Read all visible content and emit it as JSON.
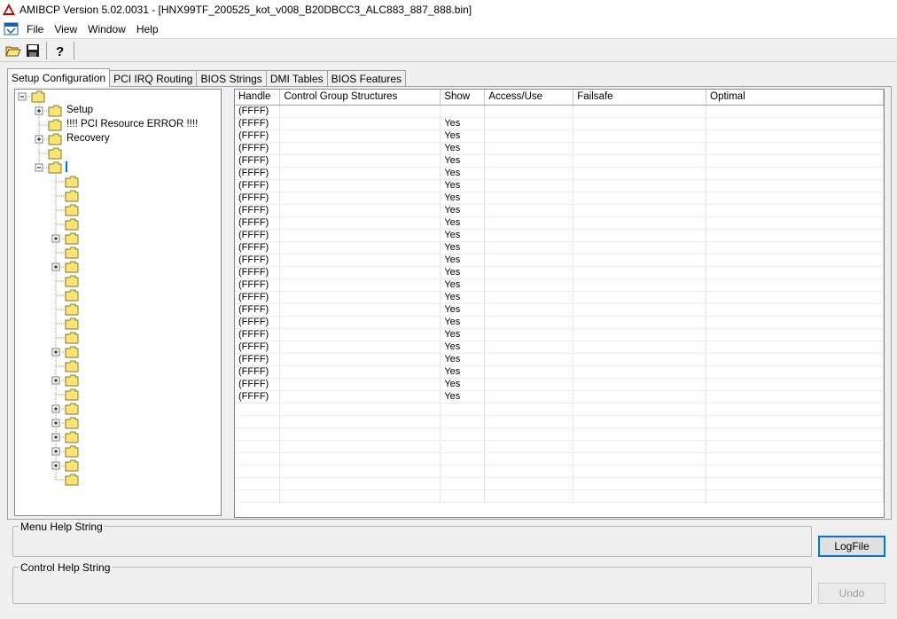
{
  "window": {
    "title": "AMIBCP Version 5.02.0031 - [HNX99TF_200525_kot_v008_B20DBCC3_ALC883_887_888.bin]"
  },
  "menu": [
    "File",
    "View",
    "Window",
    "Help"
  ],
  "toolbar": {
    "icons": [
      "open-folder-icon",
      "save-disk-icon",
      "help-question-icon"
    ]
  },
  "tabs": [
    {
      "label": "Setup Configuration",
      "active": true
    },
    {
      "label": "PCI IRQ Routing",
      "active": false
    },
    {
      "label": "BIOS Strings",
      "active": false
    },
    {
      "label": "DMI Tables",
      "active": false
    },
    {
      "label": "BIOS Features",
      "active": false
    }
  ],
  "tree": {
    "labels": {
      "setup": "Setup",
      "pci_error": "!!!! PCI Resource ERROR !!!!",
      "recovery": "Recovery"
    }
  },
  "table": {
    "columns": [
      "Handle",
      "Control Group Structures",
      "Show",
      "Access/Use",
      "Failsafe",
      "Optimal"
    ],
    "rows": [
      [
        "(FFFF)",
        "",
        "",
        "",
        "",
        ""
      ],
      [
        "(FFFF)",
        "",
        "Yes",
        "",
        "",
        ""
      ],
      [
        "(FFFF)",
        "",
        "Yes",
        "",
        "",
        ""
      ],
      [
        "(FFFF)",
        "",
        "Yes",
        "",
        "",
        ""
      ],
      [
        "(FFFF)",
        "",
        "Yes",
        "",
        "",
        ""
      ],
      [
        "(FFFF)",
        "",
        "Yes",
        "",
        "",
        ""
      ],
      [
        "(FFFF)",
        "",
        "Yes",
        "",
        "",
        ""
      ],
      [
        "(FFFF)",
        "",
        "Yes",
        "",
        "",
        ""
      ],
      [
        "(FFFF)",
        "",
        "Yes",
        "",
        "",
        ""
      ],
      [
        "(FFFF)",
        "",
        "Yes",
        "",
        "",
        ""
      ],
      [
        "(FFFF)",
        "",
        "Yes",
        "",
        "",
        ""
      ],
      [
        "(FFFF)",
        "",
        "Yes",
        "",
        "",
        ""
      ],
      [
        "(FFFF)",
        "",
        "Yes",
        "",
        "",
        ""
      ],
      [
        "(FFFF)",
        "",
        "Yes",
        "",
        "",
        ""
      ],
      [
        "(FFFF)",
        "",
        "Yes",
        "",
        "",
        ""
      ],
      [
        "(FFFF)",
        "",
        "Yes",
        "",
        "",
        ""
      ],
      [
        "(FFFF)",
        "",
        "Yes",
        "",
        "",
        ""
      ],
      [
        "(FFFF)",
        "",
        "Yes",
        "",
        "",
        ""
      ],
      [
        "(FFFF)",
        "",
        "Yes",
        "",
        "",
        ""
      ],
      [
        "(FFFF)",
        "",
        "Yes",
        "",
        "",
        ""
      ],
      [
        "(FFFF)",
        "",
        "Yes",
        "",
        "",
        ""
      ],
      [
        "(FFFF)",
        "",
        "Yes",
        "",
        "",
        ""
      ],
      [
        "(FFFF)",
        "",
        "Yes",
        "",
        "",
        ""
      ],
      [
        "(FFFF)",
        "",
        "Yes",
        "",
        "",
        ""
      ],
      [
        "",
        "",
        "",
        "",
        "",
        ""
      ],
      [
        "",
        "",
        "",
        "",
        "",
        ""
      ],
      [
        "",
        "",
        "",
        "",
        "",
        ""
      ],
      [
        "",
        "",
        "",
        "",
        "",
        ""
      ],
      [
        "",
        "",
        "",
        "",
        "",
        ""
      ],
      [
        "",
        "",
        "",
        "",
        "",
        ""
      ],
      [
        "",
        "",
        "",
        "",
        "",
        ""
      ],
      [
        "",
        "",
        "",
        "",
        "",
        ""
      ]
    ]
  },
  "help": {
    "menu_help_label": "Menu Help String",
    "control_help_label": "Control Help String"
  },
  "buttons": {
    "logfile": "LogFile",
    "undo": "Undo"
  },
  "colors": {
    "folder_fill": "#f7e47a",
    "folder_stroke": "#8a7a20",
    "accent": "#0078d7"
  }
}
